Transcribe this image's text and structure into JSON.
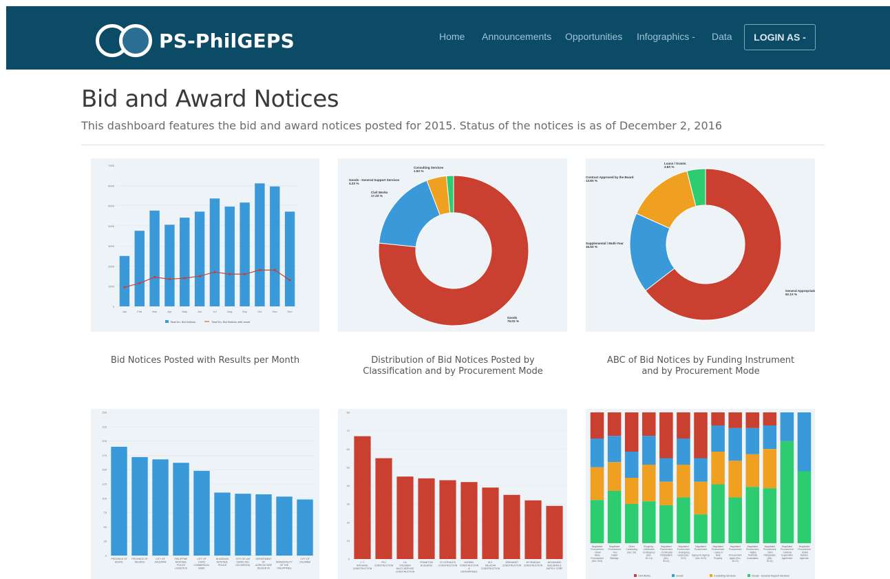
{
  "brand": {
    "name": "PS-PhilGEPS"
  },
  "nav": {
    "items": [
      "Home",
      "Announcements",
      "Opportunities",
      "Infographics -",
      "Data"
    ],
    "login": "LOGIN AS -"
  },
  "page": {
    "title": "Bid and Award Notices",
    "subtitle": "This dashboard features the bid and award notices posted for 2015. Status of the notices is as of December 2, 2016"
  },
  "captions": {
    "chart1": "Bid Notices Posted with Results per Month",
    "chart2": "Distribution of Bid Notices Posted by Classification and by Procurement Mode",
    "chart3": "ABC of Bid Notices by Funding Instrument and by Procurement Mode"
  },
  "colors": {
    "navbar": "#0b4b66",
    "blue": "#3a9ad9",
    "red": "#c94030",
    "orange": "#f0a020",
    "green": "#2ecc71",
    "panel": "#eef3f8"
  },
  "chart_data": [
    {
      "id": "monthly",
      "type": "bar",
      "categories": [
        "Jan",
        "Feb",
        "Mar",
        "Apr",
        "May",
        "Jun",
        "Jul",
        "Aug",
        "Sep",
        "Oct",
        "Nov",
        "Dec"
      ],
      "series": [
        {
          "name": "Total No. Bid Notices",
          "values": [
            2500,
            3750,
            4750,
            4050,
            4400,
            4700,
            5350,
            4950,
            5150,
            6100,
            5950,
            4700
          ]
        },
        {
          "name": "Total No. Bid Notices with result",
          "values": [
            950,
            1150,
            1450,
            1350,
            1400,
            1500,
            1700,
            1600,
            1600,
            1800,
            1800,
            1300
          ]
        }
      ],
      "ylim": [
        0,
        7000
      ],
      "yticks": [
        "0",
        "1000",
        "2000",
        "3000",
        "4000",
        "5000",
        "6000",
        "7000"
      ],
      "legend": "bottom"
    },
    {
      "id": "classification",
      "type": "pie",
      "slices": [
        {
          "label": "Goods",
          "value": 75.0,
          "text": "75.0X %",
          "color": "#c94030"
        },
        {
          "label": "Civil Works",
          "value": 17.2,
          "text": "17.2X %",
          "color": "#3a9ad9"
        },
        {
          "label": "Goods - General Support Services",
          "value": 4.2,
          "text": "4.2X %",
          "color": "#f0a020"
        },
        {
          "label": "Consulting Services",
          "value": 1.5,
          "text": "1.5X %",
          "color": "#2ecc71"
        }
      ]
    },
    {
      "id": "funding",
      "type": "pie",
      "slices": [
        {
          "label": "General Appropriation",
          "value": 62.1,
          "text": "62.1X %",
          "color": "#c94030"
        },
        {
          "label": "Supplemental / Multi-Year",
          "value": 16.5,
          "text": "16.5X %",
          "color": "#3a9ad9"
        },
        {
          "label": "Contract Approved by the Board",
          "value": 13.8,
          "text": "13.8X %",
          "color": "#f0a020"
        },
        {
          "label": "Loans / Grants",
          "value": 3.8,
          "text": "3.8X %",
          "color": "#2ecc71"
        }
      ]
    },
    {
      "id": "agencies",
      "type": "bar",
      "categories": [
        "PROVINCE OF BOHOL",
        "PROVINCE OF NEGROS",
        "CITY OF DAGUPAN",
        "PHILIPPINE NATIONAL POLICE LOGISTICS SUPPORT SERVICE",
        "CITY OF CAPIZ COMMERCIAL BANK",
        "BUKIDNON NATIONAL POLICE",
        "CITY OF LAS DAVAO DEL OCCIDENTAL",
        "DEPARTMENT OF AGRICULTURE REGION XII",
        "MUNICIPALITY OF THE PHILIPPINES",
        "CITY OF CALAMBA"
      ],
      "values": [
        190,
        172,
        168,
        162,
        148,
        110,
        108,
        107,
        103,
        98
      ],
      "ylim": [
        0,
        250
      ],
      "yticks": [
        "0",
        "25",
        "50",
        "75",
        "100",
        "125",
        "150",
        "175",
        "200",
        "225",
        "250"
      ]
    },
    {
      "id": "contractors",
      "type": "bar",
      "categories": [
        "J. Y. INTEGRAL CONSTRUCTION",
        "PDJ CONSTRUCTION",
        "J.A. CRUSHER MULTI-SERVICE CONSTRUCTION AND SUPPLIES",
        "FRANKTON BUILDERS",
        "SJ CERVALES CONSTRUCTION",
        "NORMEL CONSTRUCTION & ENTERPRISES INC",
        "W.C. SALAZAR CONSTRUCTION",
        "JERKIMNET CONSTRUCTION",
        "MY BRADAN CONSTRUCTION",
        "MONAHAND BUILDERS & SUPPLY CORP"
      ],
      "values": [
        67,
        55,
        45,
        44,
        43,
        42,
        39,
        35,
        32,
        29
      ],
      "ylim": [
        0,
        80
      ],
      "yticks": [
        "0",
        "10",
        "20",
        "30",
        "40",
        "50",
        "60",
        "70",
        "80"
      ]
    },
    {
      "id": "modes",
      "type": "bar",
      "stacked": true,
      "categories": [
        "Negotiated Procurement - Small Value Procurement (Sec. 53.9)",
        "Negotiated Procurement - Two Failed Biddings",
        "Direct Contracting (Sec. 50)",
        "Shopping - Unforeseen Contingency (Sec. 52.1.a)",
        "Negotiated Procurement - Community Participation (Sec. 53.12)",
        "Negotiated Procurement - Emergency Cases (Sec. 53.2)",
        "Negotiated Procurement - Agency-to-Agency (Sec. 53.5)",
        "Negotiated Procurement - Lease of Real Property",
        "Negotiated Procurement - Procurement Agent (Sec. 53.10)",
        "Negotiated Procurement - Highly Technical Consultants",
        "Negotiated Procurement - NGO Participation (Sec. 53.11)",
        "Negotiated Procurement - Defense Cooperation Agreement",
        "Negotiated Procurement - United Nations Agencies"
      ],
      "series": [
        {
          "name": "Civil Works",
          "values": [
            20,
            18,
            30,
            18,
            35,
            20,
            35,
            10,
            12,
            12,
            10,
            0,
            0
          ]
        },
        {
          "name": "Goods",
          "values": [
            22,
            20,
            20,
            22,
            18,
            20,
            18,
            20,
            25,
            20,
            18,
            22,
            45
          ]
        },
        {
          "name": "Consulting Services",
          "values": [
            25,
            22,
            20,
            28,
            18,
            25,
            25,
            25,
            28,
            25,
            30,
            0,
            0
          ]
        },
        {
          "name": "Goods - General Support Services",
          "values": [
            33,
            40,
            30,
            32,
            29,
            35,
            22,
            45,
            35,
            43,
            42,
            78,
            55
          ]
        }
      ],
      "ylim": [
        0,
        100
      ]
    }
  ]
}
